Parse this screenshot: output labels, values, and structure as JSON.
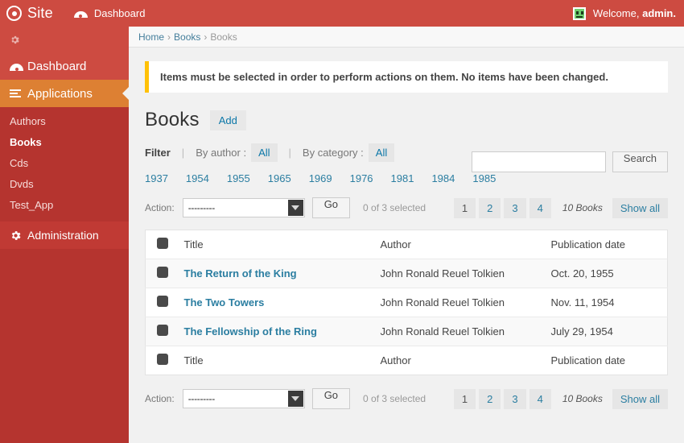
{
  "header": {
    "brand": "Site",
    "brand_logo_icon": "target-icon",
    "nav_dashboard": "Dashboard",
    "nav_dashboard_icon": "gauge-icon",
    "welcome_prefix": "Welcome,",
    "welcome_user": "admin.",
    "avatar_icon": "user-avatar-icon",
    "bar_color": "#cd4b41"
  },
  "sidebar": {
    "gear_icon": "gear-icon",
    "items": [
      {
        "label": "Dashboard",
        "icon": "gauge-icon"
      },
      {
        "label": "Applications",
        "icon": "list-icon"
      }
    ],
    "submenu": [
      {
        "label": "Authors"
      },
      {
        "label": "Books"
      },
      {
        "label": "Cds"
      },
      {
        "label": "Dvds"
      },
      {
        "label": "Test_App"
      }
    ],
    "administration": {
      "label": "Administration",
      "icon": "gear-icon"
    },
    "bg_color": "#b5342f",
    "active_color": "#dd8033"
  },
  "breadcrumb": {
    "home": "Home",
    "section": "Books",
    "current": "Books",
    "separator": "›"
  },
  "warning": {
    "text": "Items must be selected in order to perform actions on them. No items have been changed.",
    "accent_color": "#ffc107"
  },
  "page": {
    "title": "Books",
    "add_label": "Add"
  },
  "search": {
    "value": "",
    "placeholder": "",
    "button_label": "Search"
  },
  "filter": {
    "label": "Filter",
    "divider": "|",
    "by_author_label": "By author :",
    "by_author_value": "All",
    "by_category_label": "By category :",
    "by_category_value": "All",
    "years": [
      "1937",
      "1954",
      "1955",
      "1965",
      "1969",
      "1976",
      "1981",
      "1984",
      "1985"
    ]
  },
  "actionbar": {
    "label": "Action:",
    "select_value": "---------",
    "select_options": [
      "---------"
    ],
    "go_label": "Go",
    "selected_count": "0 of 3 selected"
  },
  "pagination": {
    "pages": [
      "1",
      "2",
      "3",
      "4"
    ],
    "current_page": "1",
    "total_label": "10 Books",
    "show_all_label": "Show all"
  },
  "table": {
    "columns": [
      "Title",
      "Author",
      "Publication date"
    ],
    "rows": [
      {
        "title": "The Return of the King",
        "author": "John Ronald Reuel Tolkien",
        "publication_date": "Oct. 20, 1955"
      },
      {
        "title": "The Two Towers",
        "author": "John Ronald Reuel Tolkien",
        "publication_date": "Nov. 11, 1954"
      },
      {
        "title": "The Fellowship of the Ring",
        "author": "John Ronald Reuel Tolkien",
        "publication_date": "July 29, 1954"
      }
    ]
  }
}
